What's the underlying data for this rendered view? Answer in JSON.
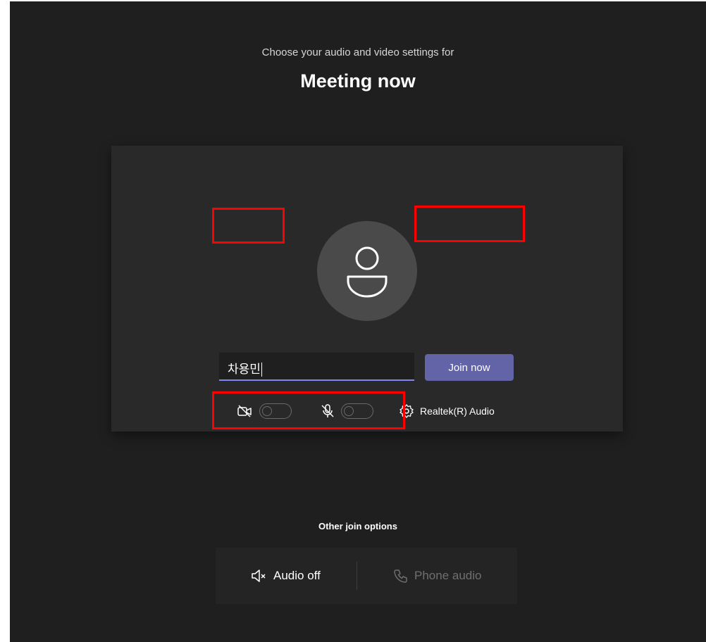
{
  "header": {
    "subtitle": "Choose your audio and video settings for",
    "title": "Meeting now"
  },
  "prejoin": {
    "name_value": "차용민",
    "join_label": "Join now",
    "camera_toggle": {
      "on": false,
      "icon": "camera-off-icon"
    },
    "mic_toggle": {
      "on": false,
      "icon": "mic-off-icon"
    },
    "audio_device_label": "Realtek(R) Audio",
    "avatar_icon": "person-icon"
  },
  "other_options": {
    "title": "Other join options",
    "audio_off_label": "Audio off",
    "phone_audio_label": "Phone audio"
  },
  "colors": {
    "background": "#1f1f1f",
    "card": "#292929",
    "accent": "#6264a7",
    "highlight": "#ff0000"
  }
}
